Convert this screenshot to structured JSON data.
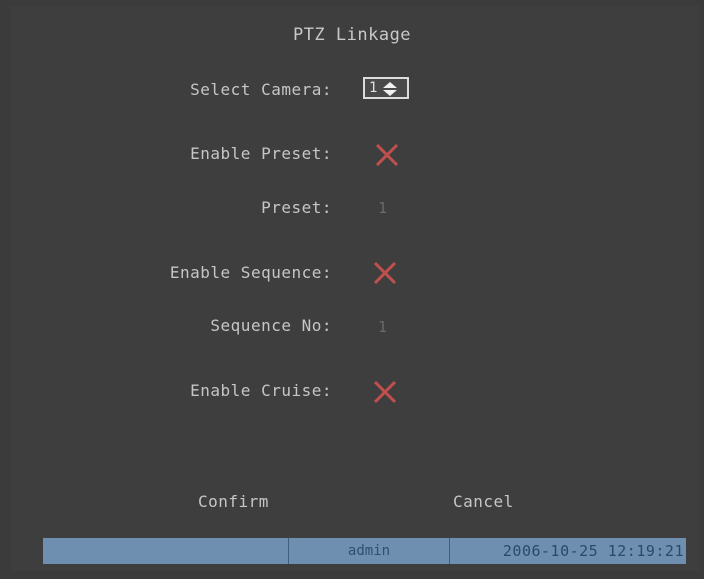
{
  "dialog": {
    "title": "PTZ Linkage"
  },
  "fields": {
    "select_camera_label": "Select Camera:",
    "select_camera_value": "1",
    "enable_preset_label": "Enable Preset:",
    "enable_preset_checked": false,
    "preset_label": "Preset:",
    "preset_value": "1",
    "enable_sequence_label": "Enable Sequence:",
    "enable_sequence_checked": false,
    "sequence_no_label": "Sequence No:",
    "sequence_no_value": "1",
    "enable_cruise_label": "Enable Cruise:",
    "enable_cruise_checked": false
  },
  "buttons": {
    "confirm_label": "Confirm",
    "cancel_label": "Cancel"
  },
  "status_bar": {
    "user": "admin",
    "datetime": "2006-10-25 12:19:21"
  },
  "colors": {
    "background": "#3e3e3e",
    "text": "#c6c6c6",
    "unchecked_mark": "#c0504d",
    "status_bar": "#6f8fb0"
  },
  "icons": {
    "unchecked": "x-mark-icon",
    "spinner": "up-down-arrows-icon"
  }
}
